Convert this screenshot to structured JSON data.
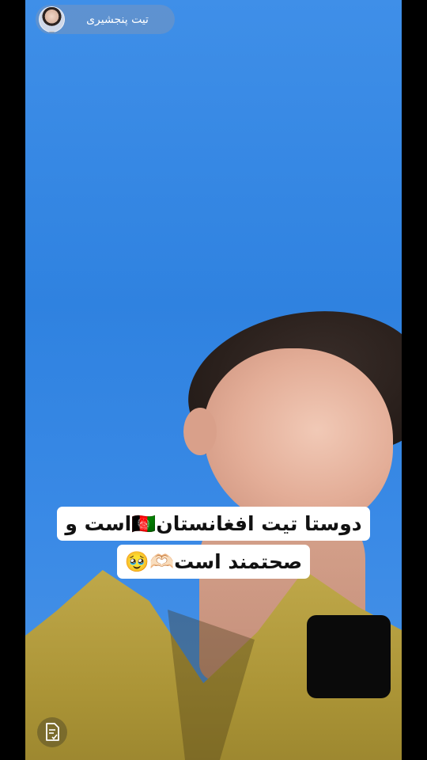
{
  "profile": {
    "name": "تیت پنجشیری",
    "avatar_icon": "profile-avatar"
  },
  "caption": {
    "line1": "دوستا تیت افغانستان🇦🇫است و",
    "line2": "صحتمند است🫶🏻🥹"
  },
  "icons": {
    "document": "document-check-icon"
  },
  "colors": {
    "sky": "#2f82e0",
    "caption_bg": "#ffffff",
    "caption_text": "#111111"
  }
}
